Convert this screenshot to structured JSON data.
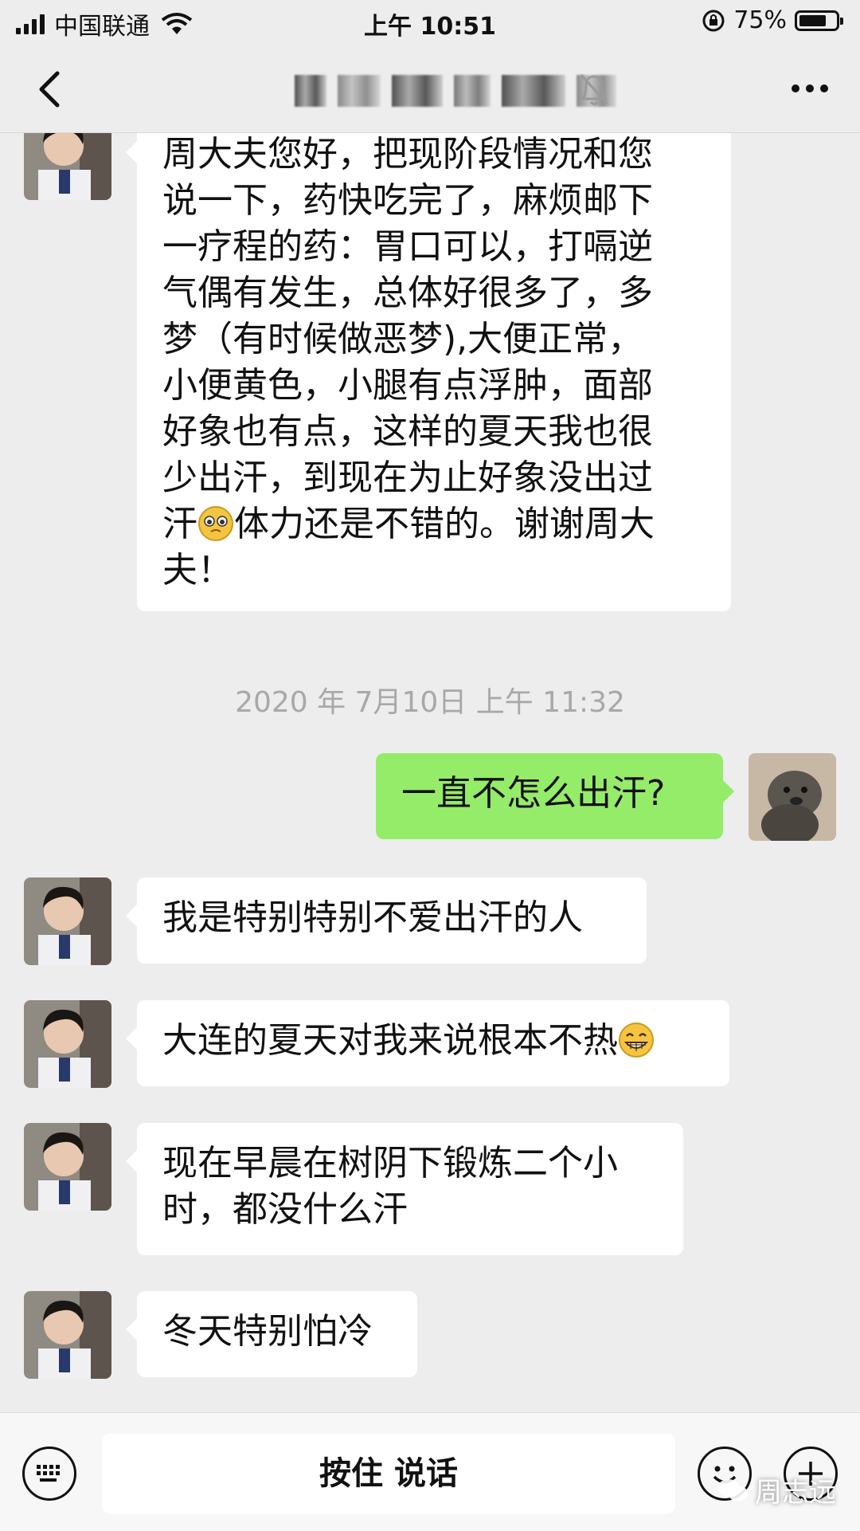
{
  "status_bar": {
    "carrier": "中国联通",
    "time": "上午 10:51",
    "battery_percent_text": "75%",
    "battery_level": 0.75
  },
  "nav": {
    "back_icon": "chevron-left-icon",
    "mute_icon": "bell-slash-icon",
    "more_icon": "more-dots-icon"
  },
  "messages": [
    {
      "side": "in",
      "text": "周大夫您好，把现阶段情况和您\n说一下，药快吃完了，麻烦邮下\n一疗程的药：胃口可以，打嗝逆\n气偶有发生，总体好很多了，多\n梦（有时候做恶梦),大便正常，\n小便黄色，小腿有点浮肿，面部\n好象也有点，这样的夏天我也很\n少出汗，到现在为止好象没出过\n汗",
      "text_after_emoji": "体力还是不错的。谢谢周大\n夫！"
    },
    {
      "side": "time",
      "text": "2020 年 7月10日 上午 11:32"
    },
    {
      "side": "out",
      "text": "一直不怎么出汗?"
    },
    {
      "side": "in",
      "text": "我是特别特别不爱出汗的人"
    },
    {
      "side": "in",
      "text": "大连的夏天对我来说根本不热"
    },
    {
      "side": "in",
      "text": "现在早晨在树阴下锻炼二个小\n时，都没什么汗"
    },
    {
      "side": "in",
      "text": "冬天特别怕冷"
    }
  ],
  "input_bar": {
    "voice_label": "按住 说话",
    "watermark": "周志远",
    "colors": {
      "out_bubble": "#95ec69",
      "in_bubble": "#ffffff",
      "background": "#ededed"
    }
  }
}
